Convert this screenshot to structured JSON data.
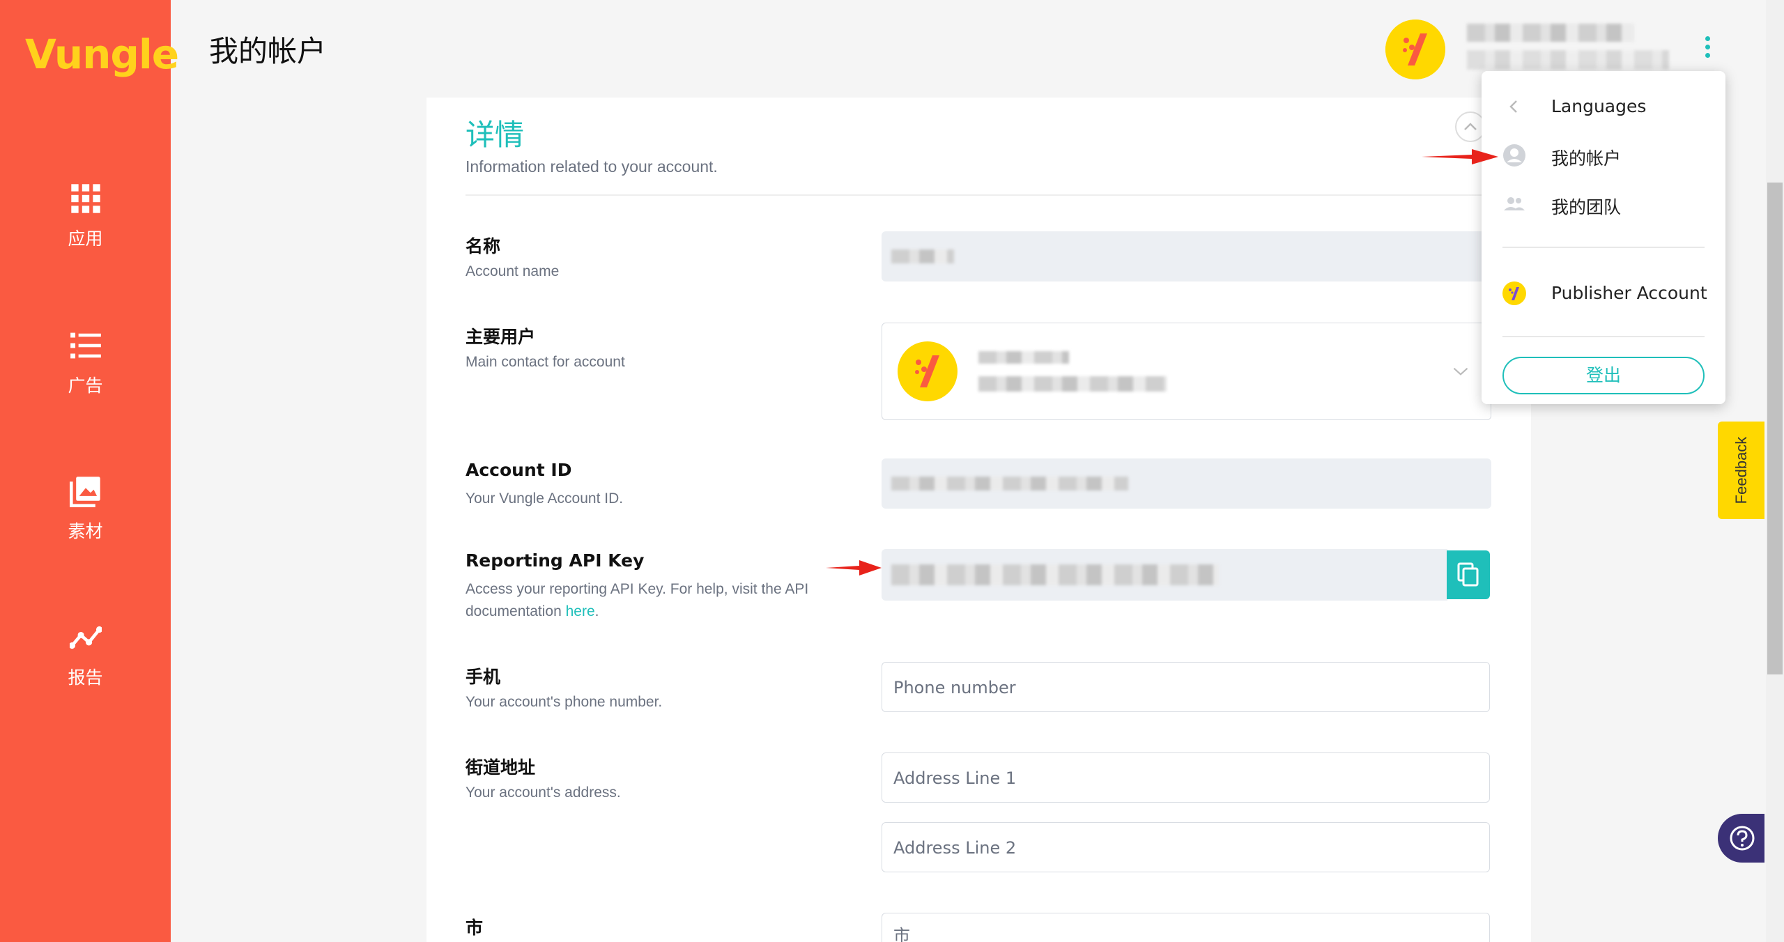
{
  "brand": {
    "logo_text": "Vungle"
  },
  "sidebar": {
    "items": [
      {
        "label": "应用"
      },
      {
        "label": "广告"
      },
      {
        "label": "素材"
      },
      {
        "label": "报告"
      }
    ]
  },
  "header": {
    "title": "我的帐户"
  },
  "details": {
    "title": "详情",
    "subtitle": "Information related to your account."
  },
  "fields": {
    "name": {
      "label": "名称",
      "desc": "Account name"
    },
    "main_user": {
      "label": "主要用户",
      "desc": "Main contact for account"
    },
    "account_id": {
      "label": "Account ID",
      "desc": "Your Vungle Account ID."
    },
    "api_key": {
      "label": "Reporting API Key",
      "desc": "Access your reporting API Key. For help, visit the API documentation",
      "link": "here",
      "after_link": "."
    },
    "phone": {
      "label": "手机",
      "desc": "Your account's phone number.",
      "placeholder": "Phone number"
    },
    "address": {
      "label": "街道地址",
      "desc": "Your account's address.",
      "placeholder1": "Address Line 1",
      "placeholder2": "Address Line 2"
    },
    "city": {
      "label": "市",
      "placeholder": "市"
    }
  },
  "menu": {
    "languages": "Languages",
    "my_account": "我的帐户",
    "my_team": "我的团队",
    "publisher": "Publisher Account",
    "logout": "登出"
  },
  "feedback": {
    "label": "Feedback"
  },
  "colors": {
    "sidebar": "#fa5a41",
    "accent": "#1fbfba",
    "brand_yellow": "#ffd800",
    "help": "#3b3177"
  }
}
